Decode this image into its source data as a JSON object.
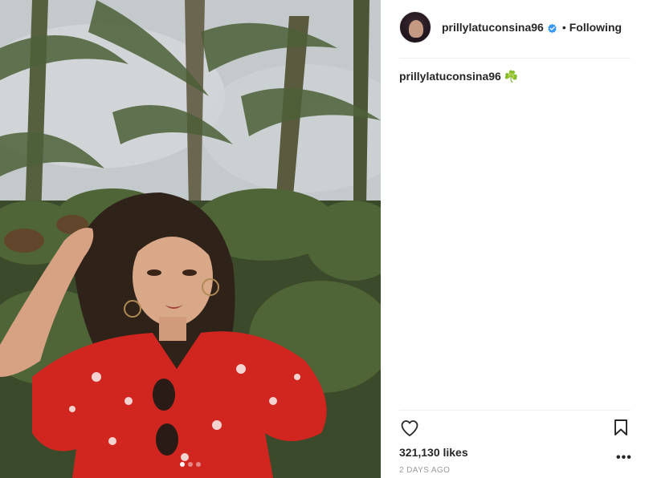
{
  "post": {
    "username": "prillylatuconsina96",
    "follow_separator": "•",
    "follow_status": "Following",
    "caption_user": "prillylatuconsina96",
    "caption_text": "☘️",
    "likes": "321,130 likes",
    "timestamp": "2 DAYS AGO",
    "more_label": "•••"
  },
  "carousel": {
    "total": 3,
    "active": 1
  },
  "icons": {
    "verified": "verified-badge-icon",
    "like": "heart-icon",
    "save": "bookmark-icon",
    "more": "more-options-icon"
  },
  "colors": {
    "text": "#262626",
    "muted": "#999999",
    "verified": "#3897f0",
    "divider": "#efefef",
    "dress": "#d0261f"
  }
}
